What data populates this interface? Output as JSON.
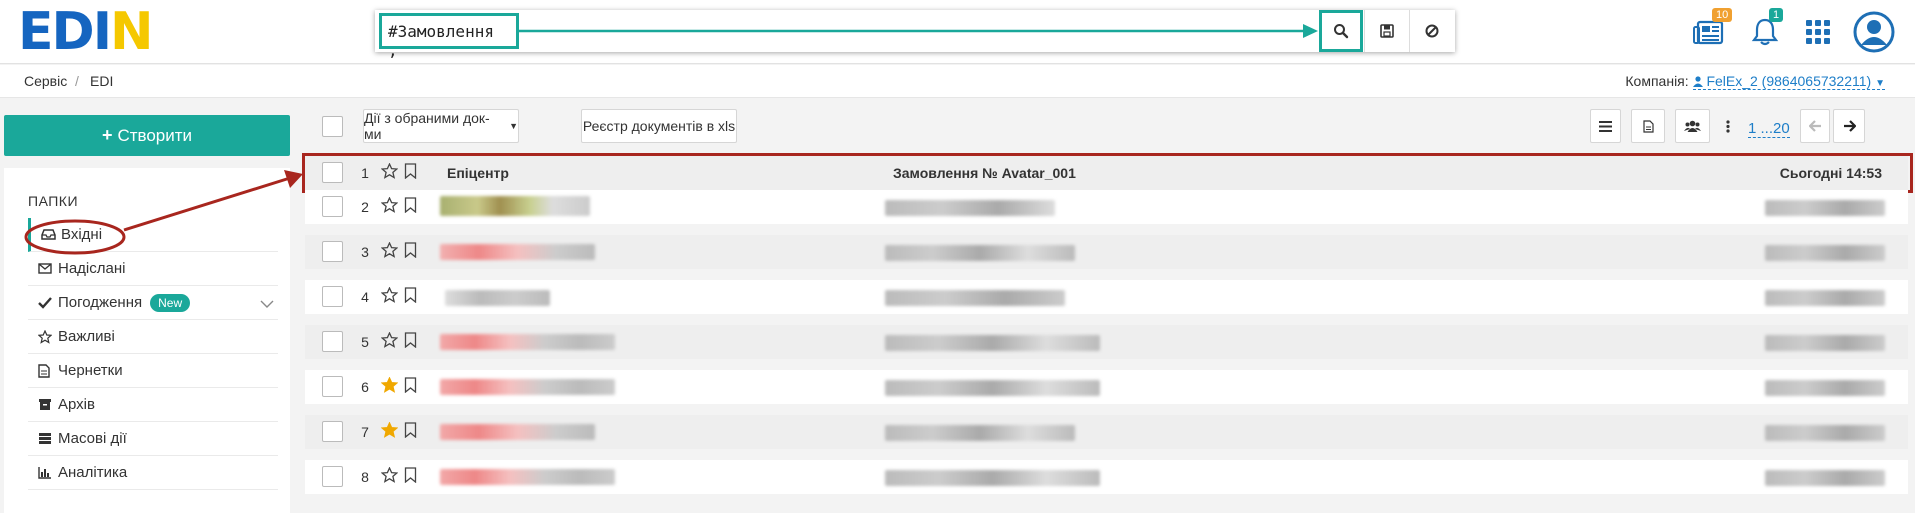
{
  "logo": {
    "part1": "ED",
    "part2": "N"
  },
  "search": {
    "value": "#Замовлення ,"
  },
  "icons": {
    "search": "search-icon",
    "save": "floppy-icon",
    "cancel": "ban-icon",
    "news": "newspaper-icon",
    "bell": "bell-icon",
    "apps": "grid-icon",
    "user": "user-avatar-icon"
  },
  "badges": {
    "news": "10",
    "bell": "1"
  },
  "breadcrumb": {
    "item1": "Сервіс",
    "sep": "/",
    "item2": "EDI"
  },
  "company": {
    "label": "Компанія:",
    "value": "FelEx_2 (9864065732211)"
  },
  "sidebar": {
    "create": "Створити",
    "folders_title": "ПАПКИ",
    "items": [
      {
        "label": "Вхідні"
      },
      {
        "label": "Надіслані"
      },
      {
        "label": "Погодження",
        "badge": "New"
      },
      {
        "label": "Важливі"
      },
      {
        "label": "Чернетки"
      },
      {
        "label": "Архів"
      },
      {
        "label": "Масові дії"
      },
      {
        "label": "Аналітика"
      }
    ]
  },
  "toolbar": {
    "bulk_actions": "Дії з обраними док-ми",
    "registry": "Реєстр документів в xls",
    "pager": "1 ...20"
  },
  "rows": [
    {
      "num": "1",
      "company": "Епіцентр",
      "doc": "Замовлення № Avatar_001",
      "date": "Сьогодні 14:53",
      "starred": false
    },
    {
      "num": "2",
      "starred": false
    },
    {
      "num": "3",
      "starred": false
    },
    {
      "num": "4",
      "starred": false
    },
    {
      "num": "5",
      "starred": false
    },
    {
      "num": "6",
      "starred": true
    },
    {
      "num": "7",
      "starred": true
    },
    {
      "num": "8",
      "starred": false
    }
  ],
  "colors": {
    "accent": "#1aa89a",
    "link": "#1e7ec8",
    "annotation": "#a8261e",
    "star": "#f0a800"
  }
}
